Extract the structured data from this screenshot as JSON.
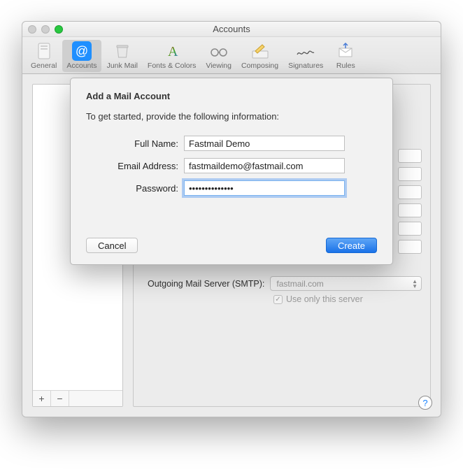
{
  "window": {
    "title": "Accounts"
  },
  "toolbar": {
    "items": [
      {
        "label": "General"
      },
      {
        "label": "Accounts"
      },
      {
        "label": "Junk Mail"
      },
      {
        "label": "Fonts & Colors"
      },
      {
        "label": "Viewing"
      },
      {
        "label": "Composing"
      },
      {
        "label": "Signatures"
      },
      {
        "label": "Rules"
      }
    ]
  },
  "sidebar": {
    "add": "+",
    "remove": "−"
  },
  "smtp": {
    "label": "Outgoing Mail Server (SMTP):",
    "value": "fastmail.com",
    "use_only": "Use only this server"
  },
  "help": "?",
  "sheet": {
    "title": "Add a Mail Account",
    "subtitle": "To get started, provide the following information:",
    "fields": {
      "full_name_label": "Full Name:",
      "full_name_value": "Fastmail Demo",
      "email_label": "Email Address:",
      "email_value": "fastmaildemo@fastmail.com",
      "password_label": "Password:",
      "password_value": "••••••••••••••"
    },
    "cancel": "Cancel",
    "create": "Create"
  }
}
